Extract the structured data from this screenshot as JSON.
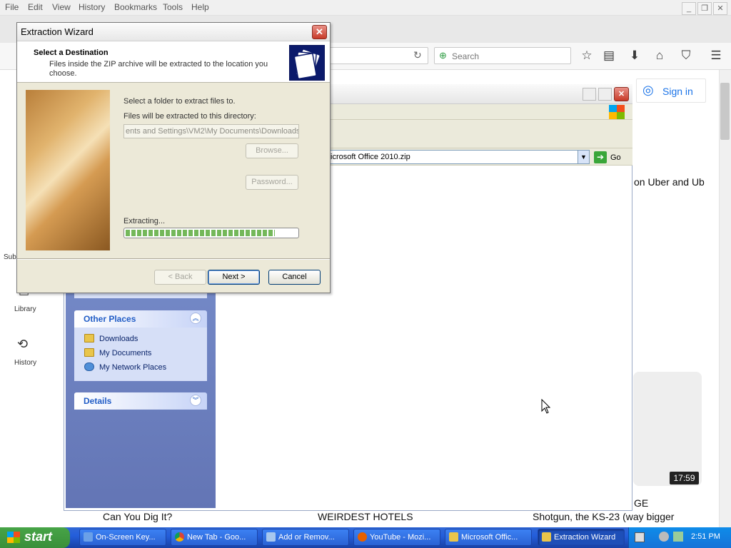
{
  "firefox": {
    "menu": [
      "File",
      "Edit",
      "View",
      "History",
      "Bookmarks",
      "Tools",
      "Help"
    ],
    "search_placeholder": "Search",
    "sign_in": "Sign in",
    "sidebar": {
      "subscriptions_partial": "Sub",
      "library": "Library",
      "history": "History"
    },
    "page_text": {
      "uber": "on Uber and Ub",
      "duration": "17:59",
      "ge": "GE",
      "title1": "Can You Dig It?",
      "title2": "WEIRDEST HOTELS",
      "title3": "Shotgun, the KS-23 (way bigger"
    }
  },
  "explorer": {
    "address": "icrosoft Office 2010.zip",
    "go_label": "Go",
    "other_places_title": "Other Places",
    "places": [
      "Downloads",
      "My Documents",
      "My Network Places"
    ],
    "details_title": "Details"
  },
  "wizard": {
    "title": "Extraction Wizard",
    "header_title": "Select a Destination",
    "header_desc": "Files inside the ZIP archive will be extracted to the location you choose.",
    "select_label": "Select a folder to extract files to.",
    "dir_label": "Files will be extracted to this directory:",
    "dir_value": "ents and Settings\\VM2\\My Documents\\Downloads",
    "browse_label": "Browse...",
    "password_label": "Password...",
    "extracting_label": "Extracting...",
    "progress": 0.87,
    "back_label": "< Back",
    "next_label": "Next >",
    "cancel_label": "Cancel"
  },
  "taskbar": {
    "start_label": "start",
    "tasks": [
      "On-Screen Key...",
      "New Tab - Goo...",
      "Add or Remov...",
      "YouTube - Mozi...",
      "Microsoft Offic...",
      "Extraction Wizard"
    ],
    "clock": "2:51 PM"
  }
}
